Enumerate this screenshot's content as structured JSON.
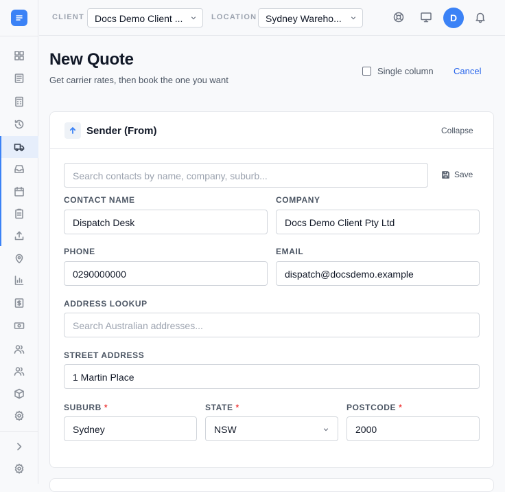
{
  "topbar": {
    "client_label": "CLIENT",
    "client_value": "Docs Demo Client ...",
    "location_label": "LOCATION",
    "location_value": "Sydney Wareho...",
    "avatar_initial": "D"
  },
  "page": {
    "title": "New Quote",
    "subtitle": "Get carrier rates, then book the one you want",
    "single_column_label": "Single column",
    "cancel_label": "Cancel"
  },
  "sender": {
    "title": "Sender (From)",
    "collapse_label": "Collapse",
    "search_placeholder": "Search contacts by name, company, suburb...",
    "save_label": "Save",
    "contact_name_label": "CONTACT NAME",
    "contact_name": "Dispatch Desk",
    "company_label": "COMPANY",
    "company": "Docs Demo Client Pty Ltd",
    "phone_label": "PHONE",
    "phone": "0290000000",
    "email_label": "EMAIL",
    "email": "dispatch@docsdemo.example",
    "address_lookup_label": "ADDRESS LOOKUP",
    "address_lookup_placeholder": "Search Australian addresses...",
    "street_label": "STREET ADDRESS",
    "street": "1 Martin Place",
    "suburb_label": "SUBURB",
    "suburb": "Sydney",
    "state_label": "STATE",
    "state": "NSW",
    "postcode_label": "POSTCODE",
    "postcode": "2000",
    "required_mark": "*"
  },
  "sidebar": {
    "icons": [
      "dashboard-icon",
      "ledger-icon",
      "calculator-icon",
      "history-icon",
      "truck-icon",
      "inbox-icon",
      "calendar-icon",
      "clipboard-icon",
      "upload-icon",
      "map-pin-icon",
      "bar-chart-icon",
      "dollar-icon",
      "cash-icon",
      "users-icon",
      "contacts-icon",
      "box-icon",
      "settings-icon",
      "chevron-right-icon",
      "settings-bottom-icon"
    ],
    "active_icon": "truck-icon"
  },
  "colors": {
    "accent": "#3b82f6",
    "link": "#2563eb",
    "required": "#ef4444"
  }
}
